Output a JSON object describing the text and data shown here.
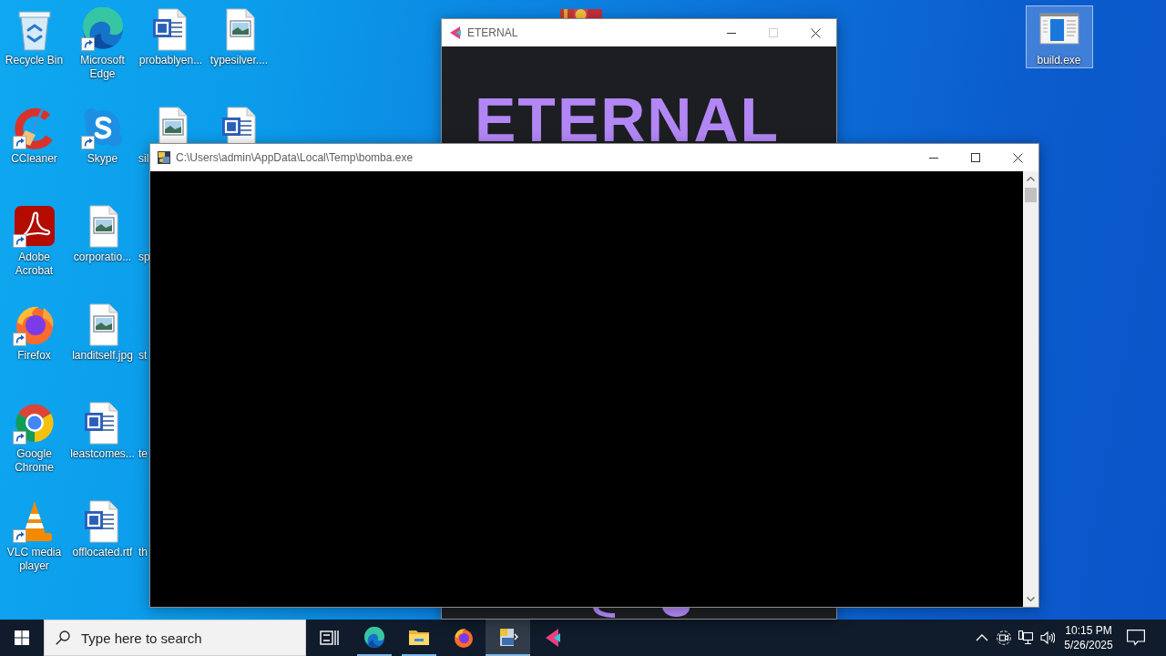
{
  "desktop": {
    "icons": [
      {
        "label": "Recycle Bin",
        "kind": "recycle-bin",
        "shortcut": false,
        "selected": false
      },
      {
        "label": "CCleaner",
        "kind": "ccleaner",
        "shortcut": true,
        "selected": false
      },
      {
        "label": "Adobe Acrobat",
        "kind": "acrobat",
        "shortcut": true,
        "selected": false
      },
      {
        "label": "Firefox",
        "kind": "firefox",
        "shortcut": true,
        "selected": false
      },
      {
        "label": "Google Chrome",
        "kind": "chrome",
        "shortcut": true,
        "selected": false
      },
      {
        "label": "VLC media player",
        "kind": "vlc",
        "shortcut": true,
        "selected": false
      },
      {
        "label": "Microsoft Edge",
        "kind": "edge",
        "shortcut": true,
        "selected": false
      },
      {
        "label": "Skype",
        "kind": "skype",
        "shortcut": true,
        "selected": false
      },
      {
        "label": "corporatio...",
        "kind": "image",
        "shortcut": false,
        "selected": false
      },
      {
        "label": "landitself.jpg",
        "kind": "image",
        "shortcut": false,
        "selected": false
      },
      {
        "label": "leastcomes...",
        "kind": "word",
        "shortcut": false,
        "selected": false
      },
      {
        "label": "offlocated.rtf",
        "kind": "word",
        "shortcut": false,
        "selected": false
      },
      {
        "label": "probablyen...",
        "kind": "word",
        "shortcut": false,
        "selected": false
      },
      {
        "label": "sil",
        "kind": "image",
        "shortcut": false,
        "selected": false
      },
      {
        "label": "sp",
        "selected": false
      },
      {
        "label": "st",
        "selected": false
      },
      {
        "label": "te",
        "selected": false
      },
      {
        "label": "th",
        "selected": false
      },
      {
        "label": "typesilver....",
        "kind": "image",
        "shortcut": false,
        "selected": false
      },
      {
        "kind": "word",
        "shortcut": false
      }
    ],
    "right_icons": [
      {
        "label": "build.exe",
        "kind": "exe",
        "shortcut": false,
        "selected": true
      }
    ],
    "hidden_icons": [
      {
        "kind": "archive"
      }
    ]
  },
  "windows": [
    {
      "kind": "app",
      "title": "ETERNAL",
      "maximize_enabled": false,
      "banner": "ETERNAL"
    },
    {
      "kind": "console",
      "title": "C:\\Users\\admin\\AppData\\Local\\Temp\\bomba.exe",
      "maximize_enabled": true
    }
  ],
  "taskbar": {
    "search": {
      "placeholder": "Type here to search"
    },
    "buttons": [
      {
        "kind": "task-view",
        "running": false,
        "selected": false
      },
      {
        "kind": "edge",
        "running": true,
        "selected": false
      },
      {
        "kind": "explorer",
        "running": true,
        "selected": false
      },
      {
        "kind": "firefox",
        "running": false,
        "selected": false
      },
      {
        "kind": "installer",
        "running": true,
        "selected": true
      },
      {
        "kind": "eternal",
        "running": false,
        "selected": false
      }
    ],
    "tray": {
      "time": "10:15 PM",
      "date": "5/26/2025"
    }
  }
}
